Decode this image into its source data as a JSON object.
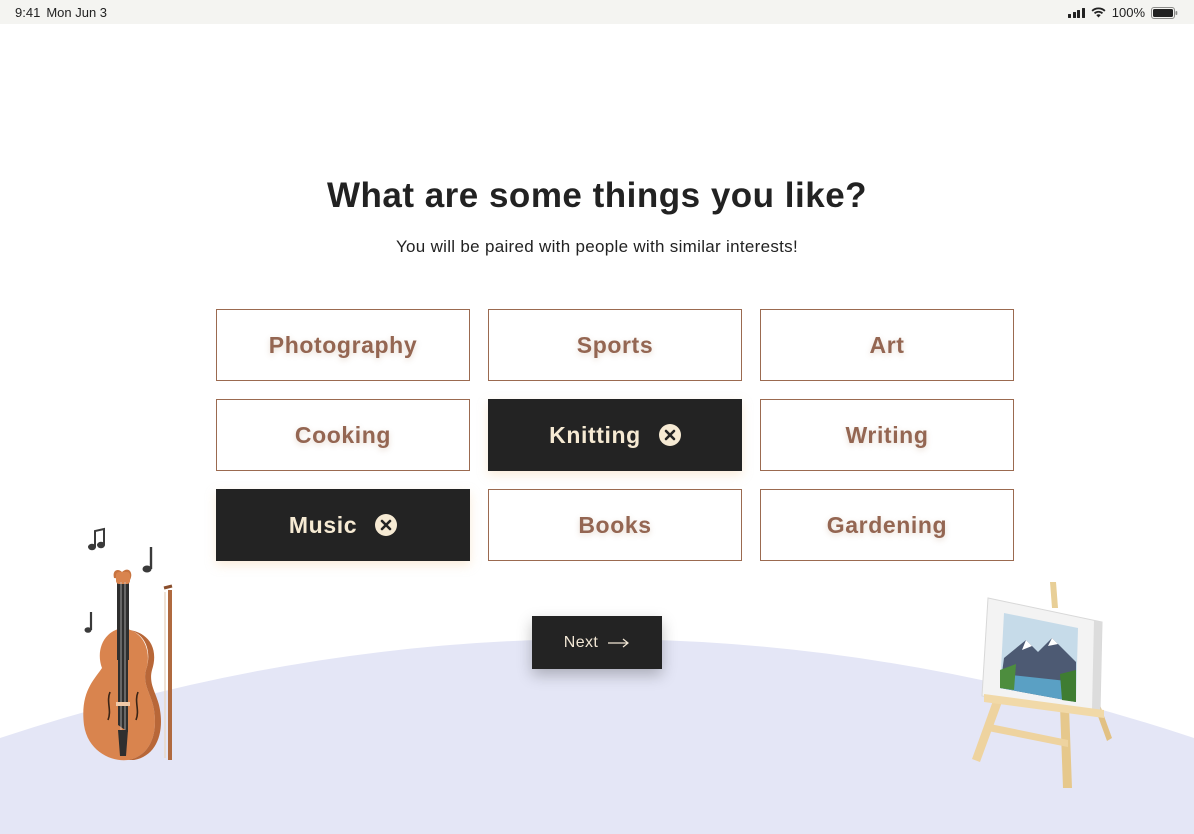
{
  "status_bar": {
    "time": "9:41",
    "date": "Mon Jun 3",
    "battery": "100%"
  },
  "heading": "What are some things you like?",
  "subheading": "You will be paired with people with similar interests!",
  "interests": [
    {
      "label": "Photography",
      "selected": false
    },
    {
      "label": "Sports",
      "selected": false
    },
    {
      "label": "Art",
      "selected": false
    },
    {
      "label": "Cooking",
      "selected": false
    },
    {
      "label": "Knitting",
      "selected": true
    },
    {
      "label": "Writing",
      "selected": false
    },
    {
      "label": "Music",
      "selected": true
    },
    {
      "label": "Books",
      "selected": false
    },
    {
      "label": "Gardening",
      "selected": false
    }
  ],
  "next_button": {
    "label": "Next"
  },
  "colors": {
    "tile_text": "#946652",
    "tile_border": "#9b6a50",
    "selected_bg": "#232323",
    "selected_text": "#f6ead3",
    "hill": "#e4e6f6"
  },
  "icons": {
    "remove": "close-circle-icon",
    "next": "arrow-right-icon"
  }
}
